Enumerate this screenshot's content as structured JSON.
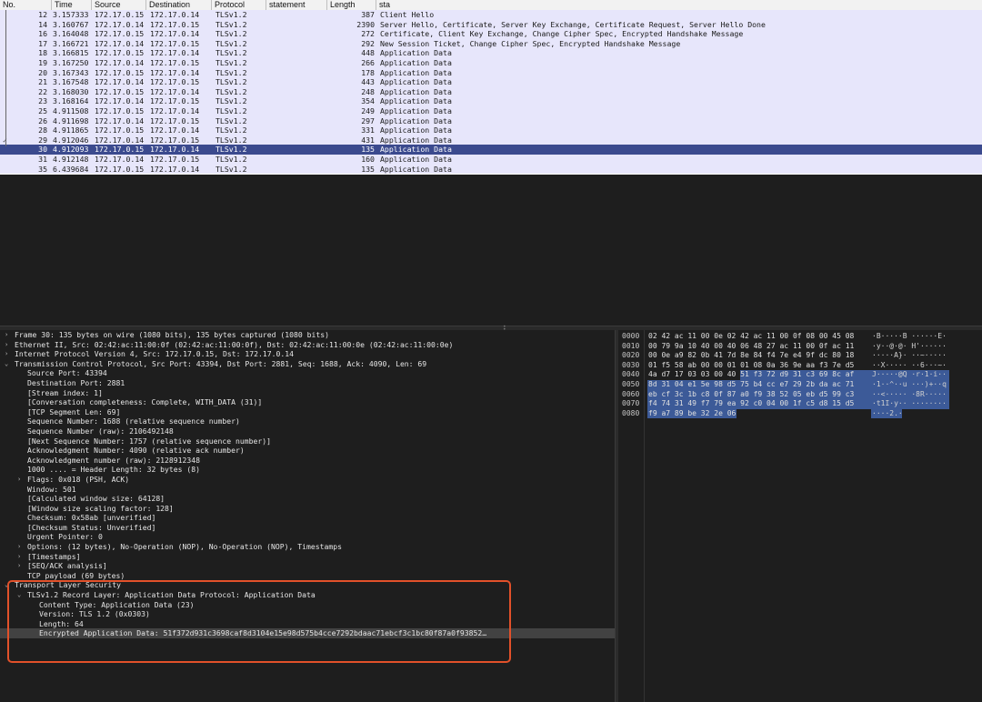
{
  "packet_list": {
    "columns": [
      "No.",
      "Time",
      "Source",
      "Destination",
      "Protocol",
      "statement",
      "Length",
      "sta"
    ],
    "rows": [
      {
        "no": "12",
        "time": "3.157333",
        "src": "172.17.0.15",
        "dst": "172.17.0.14",
        "proto": "TLSv1.2",
        "len": "387",
        "info": "Client Hello"
      },
      {
        "no": "14",
        "time": "3.160767",
        "src": "172.17.0.14",
        "dst": "172.17.0.15",
        "proto": "TLSv1.2",
        "len": "2390",
        "info": "Server Hello, Certificate, Server Key Exchange, Certificate Request, Server Hello Done"
      },
      {
        "no": "16",
        "time": "3.164048",
        "src": "172.17.0.15",
        "dst": "172.17.0.14",
        "proto": "TLSv1.2",
        "len": "272",
        "info": "Certificate, Client Key Exchange, Change Cipher Spec, Encrypted Handshake Message"
      },
      {
        "no": "17",
        "time": "3.166721",
        "src": "172.17.0.14",
        "dst": "172.17.0.15",
        "proto": "TLSv1.2",
        "len": "292",
        "info": "New Session Ticket, Change Cipher Spec, Encrypted Handshake Message"
      },
      {
        "no": "18",
        "time": "3.166815",
        "src": "172.17.0.15",
        "dst": "172.17.0.14",
        "proto": "TLSv1.2",
        "len": "448",
        "info": "Application Data"
      },
      {
        "no": "19",
        "time": "3.167250",
        "src": "172.17.0.14",
        "dst": "172.17.0.15",
        "proto": "TLSv1.2",
        "len": "266",
        "info": "Application Data"
      },
      {
        "no": "20",
        "time": "3.167343",
        "src": "172.17.0.15",
        "dst": "172.17.0.14",
        "proto": "TLSv1.2",
        "len": "178",
        "info": "Application Data"
      },
      {
        "no": "21",
        "time": "3.167548",
        "src": "172.17.0.14",
        "dst": "172.17.0.15",
        "proto": "TLSv1.2",
        "len": "443",
        "info": "Application Data"
      },
      {
        "no": "22",
        "time": "3.168030",
        "src": "172.17.0.15",
        "dst": "172.17.0.14",
        "proto": "TLSv1.2",
        "len": "248",
        "info": "Application Data"
      },
      {
        "no": "23",
        "time": "3.168164",
        "src": "172.17.0.14",
        "dst": "172.17.0.15",
        "proto": "TLSv1.2",
        "len": "354",
        "info": "Application Data"
      },
      {
        "no": "25",
        "time": "4.911508",
        "src": "172.17.0.15",
        "dst": "172.17.0.14",
        "proto": "TLSv1.2",
        "len": "249",
        "info": "Application Data"
      },
      {
        "no": "26",
        "time": "4.911698",
        "src": "172.17.0.14",
        "dst": "172.17.0.15",
        "proto": "TLSv1.2",
        "len": "297",
        "info": "Application Data"
      },
      {
        "no": "28",
        "time": "4.911865",
        "src": "172.17.0.15",
        "dst": "172.17.0.14",
        "proto": "TLSv1.2",
        "len": "331",
        "info": "Application Data"
      },
      {
        "no": "29",
        "time": "4.912046",
        "src": "172.17.0.14",
        "dst": "172.17.0.15",
        "proto": "TLSv1.2",
        "len": "431",
        "info": "Application Data"
      },
      {
        "no": "30",
        "time": "4.912093",
        "src": "172.17.0.15",
        "dst": "172.17.0.14",
        "proto": "TLSv1.2",
        "len": "135",
        "info": "Application Data",
        "selected": true
      },
      {
        "no": "31",
        "time": "4.912148",
        "src": "172.17.0.14",
        "dst": "172.17.0.15",
        "proto": "TLSv1.2",
        "len": "160",
        "info": "Application Data"
      },
      {
        "no": "35",
        "time": "6.439684",
        "src": "172.17.0.15",
        "dst": "172.17.0.14",
        "proto": "TLSv1.2",
        "len": "135",
        "info": "Application Data"
      }
    ]
  },
  "details": {
    "rows": [
      {
        "arrow": "›",
        "text": "Frame 30: 135 bytes on wire (1080 bits), 135 bytes captured (1080 bits)",
        "level": 0
      },
      {
        "arrow": "›",
        "text": "Ethernet II, Src: 02:42:ac:11:00:0f (02:42:ac:11:00:0f), Dst: 02:42:ac:11:00:0e (02:42:ac:11:00:0e)",
        "level": 0
      },
      {
        "arrow": "›",
        "text": "Internet Protocol Version 4, Src: 172.17.0.15, Dst: 172.17.0.14",
        "level": 0
      },
      {
        "arrow": "⌄",
        "text": "Transmission Control Protocol, Src Port: 43394, Dst Port: 2881, Seq: 1688, Ack: 4090, Len: 69",
        "level": 0
      },
      {
        "arrow": "",
        "text": "Source Port: 43394",
        "level": 1
      },
      {
        "arrow": "",
        "text": "Destination Port: 2881",
        "level": 1
      },
      {
        "arrow": "",
        "text": "[Stream index: 1]",
        "level": 1
      },
      {
        "arrow": "",
        "text": "[Conversation completeness: Complete, WITH_DATA (31)]",
        "level": 1
      },
      {
        "arrow": "",
        "text": "[TCP Segment Len: 69]",
        "level": 1
      },
      {
        "arrow": "",
        "text": "Sequence Number: 1688    (relative sequence number)",
        "level": 1
      },
      {
        "arrow": "",
        "text": "Sequence Number (raw): 2106492148",
        "level": 1
      },
      {
        "arrow": "",
        "text": "[Next Sequence Number: 1757    (relative sequence number)]",
        "level": 1
      },
      {
        "arrow": "",
        "text": "Acknowledgment Number: 4090    (relative ack number)",
        "level": 1
      },
      {
        "arrow": "",
        "text": "Acknowledgment number (raw): 2128912348",
        "level": 1
      },
      {
        "arrow": "",
        "text": "1000 .... = Header Length: 32 bytes (8)",
        "level": 1
      },
      {
        "arrow": "›",
        "text": "Flags: 0x018 (PSH, ACK)",
        "level": 1
      },
      {
        "arrow": "",
        "text": "Window: 501",
        "level": 1
      },
      {
        "arrow": "",
        "text": "[Calculated window size: 64128]",
        "level": 1
      },
      {
        "arrow": "",
        "text": "[Window size scaling factor: 128]",
        "level": 1
      },
      {
        "arrow": "",
        "text": "Checksum: 0x58ab [unverified]",
        "level": 1
      },
      {
        "arrow": "",
        "text": "[Checksum Status: Unverified]",
        "level": 1
      },
      {
        "arrow": "",
        "text": "Urgent Pointer: 0",
        "level": 1
      },
      {
        "arrow": "›",
        "text": "Options: (12 bytes), No-Operation (NOP), No-Operation (NOP), Timestamps",
        "level": 1
      },
      {
        "arrow": "›",
        "text": "[Timestamps]",
        "level": 1
      },
      {
        "arrow": "›",
        "text": "[SEQ/ACK analysis]",
        "level": 1
      },
      {
        "arrow": "",
        "text": "TCP payload (69 bytes)",
        "level": 1
      },
      {
        "arrow": "⌄",
        "text": "Transport Layer Security",
        "level": 0
      },
      {
        "arrow": "⌄",
        "text": "TLSv1.2 Record Layer: Application Data Protocol: Application Data",
        "level": 1
      },
      {
        "arrow": "",
        "text": "Content Type: Application Data (23)",
        "level": 2
      },
      {
        "arrow": "",
        "text": "Version: TLS 1.2 (0x0303)",
        "level": 2
      },
      {
        "arrow": "",
        "text": "Length: 64",
        "level": 2
      },
      {
        "arrow": "",
        "text": "Encrypted Application Data: 51f372d931c3698caf8d3104e15e98d575b4cce7292bdaac71ebcf3c1bc80f87a0f93852…",
        "level": 2,
        "selected": true
      }
    ]
  },
  "hex": {
    "rows": [
      {
        "offset": "0000",
        "bytes": "02 42 ac 11 00 0e 02 42  ac 11 00 0f 08 00 45 08",
        "ascii": "·B·····B ······E·"
      },
      {
        "offset": "0010",
        "bytes": "00 79 9a 10 40 00 40 06  48 27 ac 11 00 0f ac 11",
        "ascii": "·y··@·@· H'······"
      },
      {
        "offset": "0020",
        "bytes": "00 0e a9 82 0b 41 7d 8e  84 f4 7e e4 9f dc 80 18",
        "ascii": "·····A}· ··~·····"
      },
      {
        "offset": "0030",
        "bytes": "01 f5 58 ab 00 00 01 01  08 0a 36 9e aa f3 7e d5",
        "ascii": "··X····· ··6···~·"
      },
      {
        "offset": "0040",
        "bytes": "4a d7 17 03 03 00 40 51  f3 72 d9 31 c3 69 8c af",
        "ascii": "J·····@Q ·r·1·i··"
      },
      {
        "offset": "0050",
        "bytes": "8d 31 04 e1 5e 98 d5 75  b4 cc e7 29 2b da ac 71",
        "ascii": "·1··^··u ···)+··q"
      },
      {
        "offset": "0060",
        "bytes": "eb cf 3c 1b c8 0f 87 a0  f9 38 52 05 eb d5 99 c3",
        "ascii": "··<····· ·8R·····"
      },
      {
        "offset": "0070",
        "bytes": "f4 74 31 49 f7 79 ea 92  c0 04 00 1f c5 d8 15 d5",
        "ascii": "·t1I·y·· ········"
      },
      {
        "offset": "0080",
        "bytes": "f9 a7 89 be 32 2e 06",
        "ascii": "····2.·"
      }
    ]
  }
}
